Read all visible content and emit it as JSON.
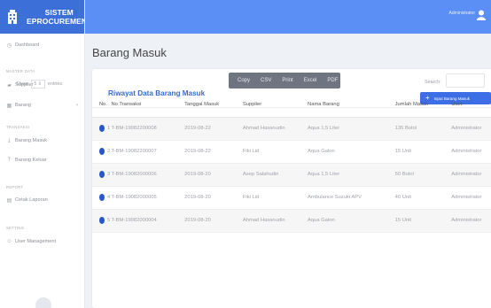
{
  "brand": {
    "line1": "SISTEM",
    "line2": "EPROCUREMENT"
  },
  "sidebar": {
    "dashboard": "Dashboard",
    "section_master": "MASTER DATA",
    "supplier": "Supplier",
    "barang": "Barang",
    "section_transaksi": "TRANSAKSI",
    "barang_masuk": "Barang Masuk",
    "barang_keluar": "Barang Keluar",
    "section_report": "REPORT",
    "cetak_laporan": "Cetak Laporan",
    "section_setting": "SETTING",
    "user_management": "User Management"
  },
  "topbar": {
    "user": "Administrator"
  },
  "page": {
    "title": "Barang Masuk"
  },
  "card": {
    "title": "Riwayat Data Barang Masuk",
    "input_button": "Input Barang Masuk",
    "show_label": "Show",
    "show_value": "5",
    "entries_label": "entries",
    "search_label": "Search:"
  },
  "export": {
    "copy": "Copy",
    "csv": "CSV",
    "print": "Print",
    "excel": "Excel",
    "pdf": "PDF"
  },
  "table": {
    "headers": [
      "No.",
      "No Transaksi",
      "Tanggal Masuk",
      "Supplier",
      "Nama Barang",
      "Jumlah Masuk",
      "User"
    ],
    "rows": [
      [
        "1",
        "T-BM-19082200008",
        "2019-08-22",
        "Ahmad Hasanudin",
        "Aqua 1,5 Liter",
        "135 Botol",
        "Administrator"
      ],
      [
        "2",
        "T-BM-19082200007",
        "2019-08-22",
        "Fiki Lid",
        "Aqua Galon",
        "15 Unit",
        "Administrator"
      ],
      [
        "3",
        "T-BM-19082000006",
        "2019-08-20",
        "Asep Salahudin",
        "Aqua 1,5 Liter",
        "50 Botol",
        "Administrator"
      ],
      [
        "4",
        "T-BM-19082000005",
        "2019-08-20",
        "Fiki Lid",
        "Ambulance Suzuki APV",
        "40 Unit",
        "Administrator"
      ],
      [
        "5",
        "T-BM-19082000004",
        "2019-08-20",
        "Ahmad Hasanudin",
        "Aqua Galon",
        "15 Unit",
        "Administrator"
      ]
    ]
  }
}
